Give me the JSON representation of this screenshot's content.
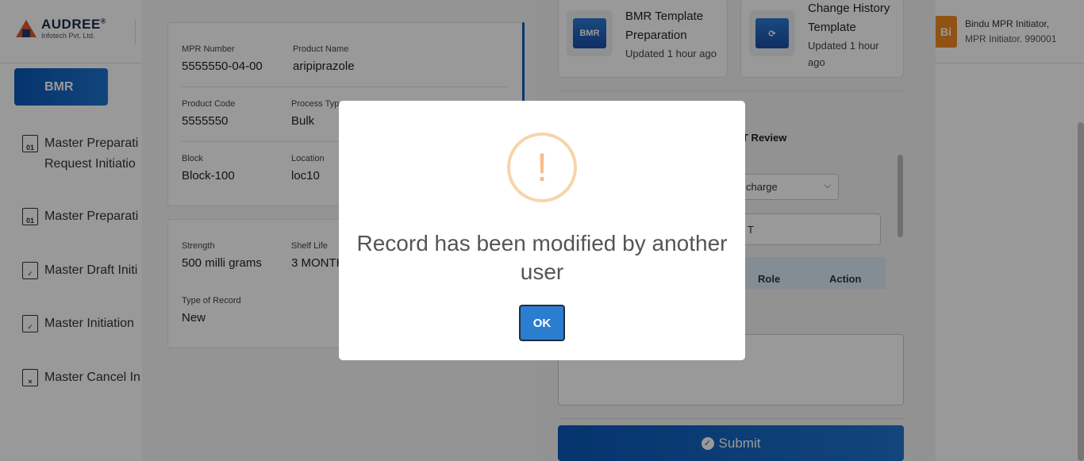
{
  "app": {
    "logo_name": "AUDREE",
    "logo_reg": "®",
    "logo_sub": "Infotech Pvt. Ltd.",
    "user_initials": "Bi",
    "user_name": "Bindu MPR Initiator,",
    "user_role": "MPR Initiator. 990001"
  },
  "sidebar": {
    "tab_label": "BMR",
    "items": [
      {
        "label": "Master Preparati",
        "label2": "Request Initiatio",
        "icon": "01"
      },
      {
        "label": "Master Preparati",
        "icon": "01"
      },
      {
        "label": "Master Draft Initi",
        "icon": "✓"
      },
      {
        "label": "Master Initiation",
        "icon": "✓"
      },
      {
        "label": "Master Cancel In",
        "icon": "×"
      }
    ]
  },
  "details": {
    "mpr_number_label": "MPR Number",
    "mpr_number": "5555550-04-00",
    "product_name_label": "Product Name",
    "product_name": "aripiprazole",
    "product_code_label": "Product Code",
    "product_code": "5555550",
    "process_type_label": "Process Typ",
    "process_type": "Bulk",
    "block_label": "Block",
    "block": "Block-100",
    "location_label": "Location",
    "location": "loc10",
    "strength_label": "Strength",
    "strength": "500 milli grams",
    "shelf_life_label": "Shelf Life",
    "shelf_life": "3 MONTH",
    "type_of_record_label": "Type of Record",
    "type_of_record": "New"
  },
  "templates": [
    {
      "icon_text": "BMR",
      "title_line1": "BMR Template",
      "title_line2": "Preparation",
      "updated": "Updated 1 hour ago"
    },
    {
      "icon_text": "⟳",
      "title_line1": "Change History",
      "title_line2": "Template",
      "updated": "Updated 1 hour",
      "updated2": "ago"
    }
  ],
  "review": {
    "label": "T Review",
    "select_value": "charge",
    "input_value": "T",
    "col_role": "Role",
    "col_action": "Action"
  },
  "submit_label": "Submit",
  "modal": {
    "title": "Record has been modified by another user",
    "icon": "!",
    "ok_label": "OK"
  }
}
